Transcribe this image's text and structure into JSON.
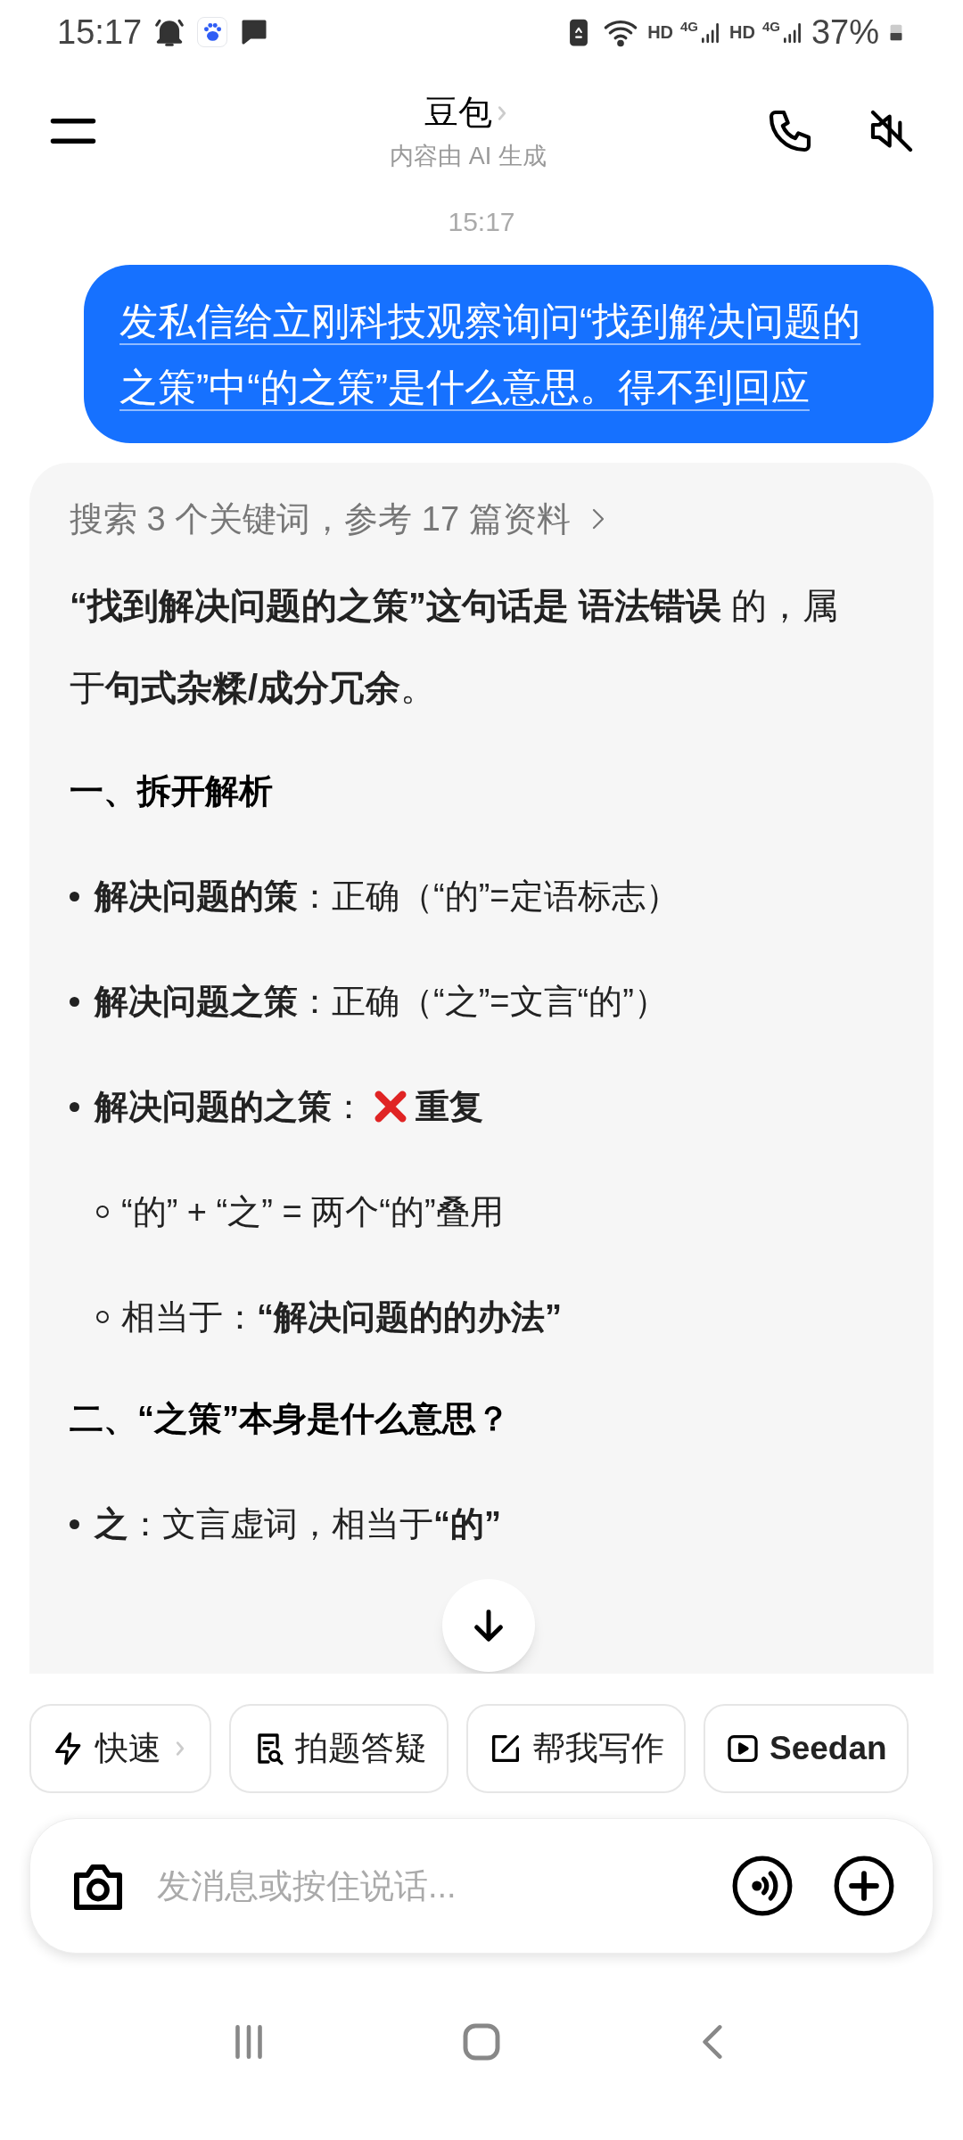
{
  "status_bar": {
    "time": "15:17",
    "network": [
      "HD",
      "4G",
      "HD",
      "4G"
    ],
    "battery": "37%"
  },
  "header": {
    "title": "豆包",
    "subtitle": "内容由 AI 生成"
  },
  "timestamp": "15:17",
  "user_message": "发私信给立刚科技观察询问“找到解决问题的之策”中“的之策”是什么意思。得不到回应",
  "answer": {
    "search_summary": "搜索 3 个关键词，参考 17 篇资料",
    "blocks": [
      {
        "kind": "paragraph",
        "text": "**“找到解决问题的之策”这句话是 语法错误** 的，属于**句式杂糅/成分冗余**。"
      },
      {
        "kind": "heading",
        "text": "一、拆开解析"
      },
      {
        "kind": "bullet",
        "text": "**解决问题的策**：正确（“的”=定语标志）"
      },
      {
        "kind": "bullet",
        "text": "**解决问题之策**：正确（“之”=文言“的”）"
      },
      {
        "kind": "bullet",
        "text": "**解决问题的之策**：",
        "cross": true,
        "tail": "**重复**"
      },
      {
        "kind": "subbullet",
        "text": "“的” + “之” = 两个“的”叠用"
      },
      {
        "kind": "subbullet",
        "text": "相当于：**“解决问题的的办法”**"
      },
      {
        "kind": "heading",
        "text": "二、“之策”本身是什么意思？"
      },
      {
        "kind": "bullet",
        "text": "**之**：文言虚词，相当于**“的”**"
      }
    ]
  },
  "chips": [
    {
      "label": "快速",
      "chevron": true
    },
    {
      "label": "拍题答疑",
      "chevron": false
    },
    {
      "label": "帮我写作",
      "chevron": false
    },
    {
      "label": "Seedan",
      "chevron": false
    }
  ],
  "input": {
    "placeholder": "发消息或按住说话..."
  }
}
